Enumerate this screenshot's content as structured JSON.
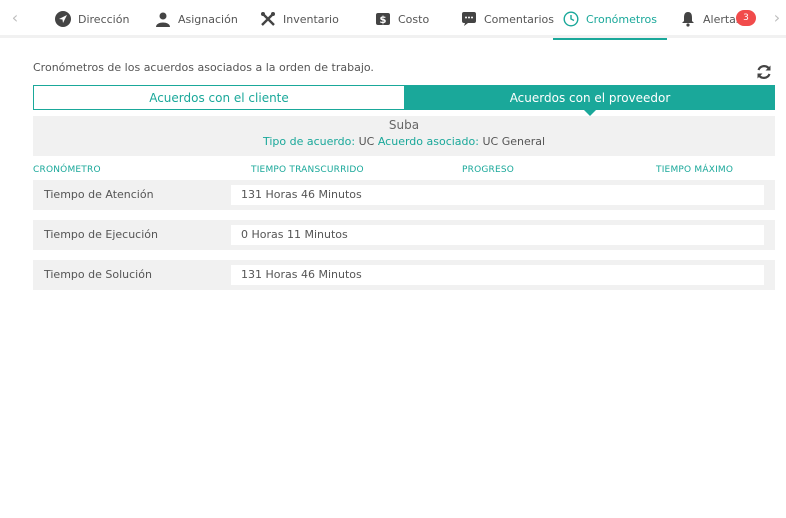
{
  "nav": {
    "tabs": [
      {
        "label": "Dirección",
        "icon": "navigation-arrow-icon"
      },
      {
        "label": "Asignación",
        "icon": "user-icon"
      },
      {
        "label": "Inventario",
        "icon": "tools-icon"
      },
      {
        "label": "Costo",
        "icon": "money-icon"
      },
      {
        "label": "Comentarios",
        "icon": "comment-icon"
      },
      {
        "label": "Cronómetros",
        "icon": "clock-icon",
        "active": true
      },
      {
        "label": "Alertas",
        "icon": "bell-icon",
        "badge": "3"
      }
    ]
  },
  "content": {
    "description": "Cronómetros de los acuerdos asociados a la orden de trabajo.",
    "segments": {
      "client": "Acuerdos con el cliente",
      "provider": "Acuerdos con el proveedor",
      "active": "provider"
    },
    "agreement": {
      "name": "Suba",
      "type_label": "Tipo de acuerdo:",
      "type_value": "UC",
      "assoc_label": "Acuerdo asociado:",
      "assoc_value": "UC General"
    },
    "columns": {
      "timer": "CRONÓMETRO",
      "elapsed": "TIEMPO TRANSCURRIDO",
      "progress": "PROGRESO",
      "max": "TIEMPO MÁXIMO"
    },
    "rows": [
      {
        "label": "Tiempo de Atención",
        "value": "131 Horas 46 Minutos"
      },
      {
        "label": "Tiempo de Ejecución",
        "value": "0 Horas 11 Minutos"
      },
      {
        "label": "Tiempo de Solución",
        "value": "131 Horas 46 Minutos"
      }
    ]
  },
  "colors": {
    "accent": "#1aa89a",
    "badge": "#f14b4b",
    "panel": "#f1f1f1"
  }
}
